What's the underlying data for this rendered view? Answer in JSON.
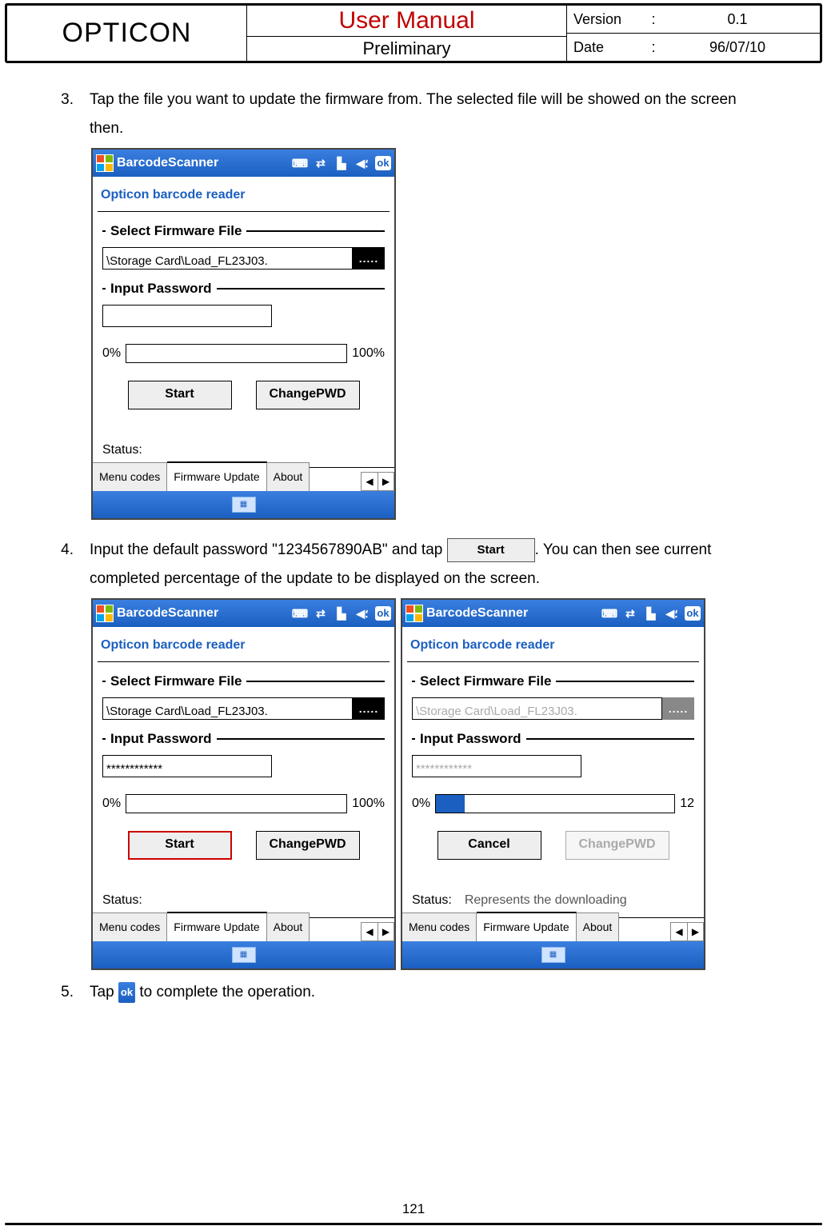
{
  "header": {
    "brand": "OPTICON",
    "title": "User Manual",
    "subtitle": "Preliminary",
    "version_key": "Version",
    "version_val": "0.1",
    "date_key": "Date",
    "date_val": "96/07/10",
    "colon": ":"
  },
  "steps": {
    "s3_num": "3.",
    "s3_text": "Tap the file you want to update the firmware from. The selected file will be showed on the screen then.",
    "s4_num": "4.",
    "s4_a": "Input the default password \"1234567890AB\" and tap ",
    "s4_b": ". You can then see current completed percentage of the update to be displayed on the screen.",
    "inline_start": "Start",
    "s5_num": "5.",
    "s5_a": "Tap ",
    "s5_b": " to complete the operation.",
    "inline_ok": "ok"
  },
  "screen": {
    "titlebar": "BarcodeScanner",
    "ok": "ok",
    "app_title": "Opticon barcode reader",
    "group_file": "Select Firmware File",
    "group_pwd": "Input Password",
    "file_path": "\\Storage Card\\Load_FL23J03.",
    "browse": ".....",
    "pct0": "0%",
    "pct100": "100%",
    "pct12": "12",
    "btn_start": "Start",
    "btn_changepwd": "ChangePWD",
    "btn_cancel": "Cancel",
    "status_label": "Status:",
    "status_download": "Represents the downloading",
    "tab_menu": "Menu codes",
    "tab_fw": "Firmware Update",
    "tab_about": "About",
    "masked": "************"
  },
  "page_number": "121"
}
